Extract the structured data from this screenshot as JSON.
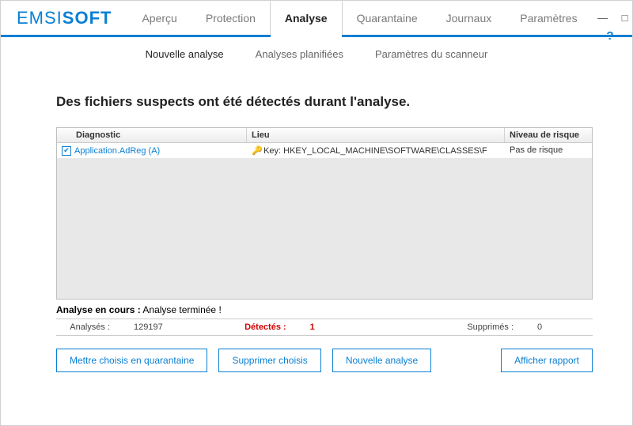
{
  "brand": {
    "prefix": "EMSI",
    "suffix": "SOFT"
  },
  "window_controls": {
    "minimize": "—",
    "maximize": "□",
    "close": "✕",
    "help": "?"
  },
  "main_tabs": [
    "Aperçu",
    "Protection",
    "Analyse",
    "Quarantaine",
    "Journaux",
    "Paramètres"
  ],
  "main_tab_active_index": 2,
  "sub_tabs": [
    "Nouvelle analyse",
    "Analyses planifiées",
    "Paramètres du scanneur"
  ],
  "sub_tab_active_index": 0,
  "heading": "Des fichiers suspects ont été détectés durant l'analyse.",
  "grid": {
    "headers": {
      "diagnostic": "Diagnostic",
      "lieu": "Lieu",
      "risque": "Niveau de risque"
    },
    "rows": [
      {
        "checked": true,
        "diagnostic": "Application.AdReg (A)",
        "lieu_icon": "registry-key-icon",
        "lieu": "Key: HKEY_LOCAL_MACHINE\\SOFTWARE\\CLASSES\\F",
        "risque": "Pas de risque"
      }
    ]
  },
  "status": {
    "label": "Analyse en cours :",
    "value": "Analyse terminée !"
  },
  "stats": {
    "analysed_label": "Analysés :",
    "analysed_value": "129197",
    "detected_label": "Détectés :",
    "detected_value": "1",
    "deleted_label": "Supprimés :",
    "deleted_value": "0"
  },
  "buttons": {
    "quarantine": "Mettre choisis en quarantaine",
    "delete": "Supprimer choisis",
    "new_scan": "Nouvelle analyse",
    "report": "Afficher rapport"
  }
}
